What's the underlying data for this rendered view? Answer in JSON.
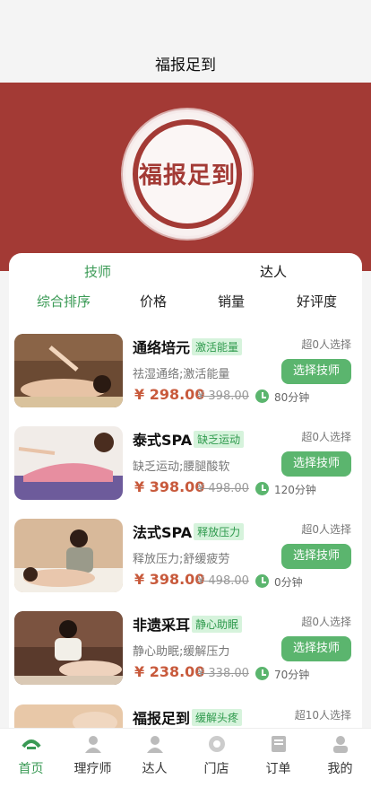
{
  "header": {
    "title": "福报足到"
  },
  "banner": {
    "logo_text": "福报足到"
  },
  "tabs": [
    {
      "label": "技师"
    },
    {
      "label": "达人"
    }
  ],
  "sorts": [
    {
      "label": "综合排序"
    },
    {
      "label": "价格"
    },
    {
      "label": "销量"
    },
    {
      "label": "好评度"
    }
  ],
  "services": [
    {
      "name": "通络培元",
      "tag": "激活能量",
      "count": "超0人选择",
      "desc": "祛湿通络;激活能量",
      "button": "选择技师",
      "price": "¥ 298.00",
      "orig_price": "¥ 398.00",
      "duration": "80分钟"
    },
    {
      "name": "泰式SPA",
      "tag": "缺乏运动",
      "count": "超0人选择",
      "desc": "缺乏运动;腰腿酸软",
      "button": "选择技师",
      "price": "¥ 398.00",
      "orig_price": "¥ 498.00",
      "duration": "120分钟"
    },
    {
      "name": "法式SPA",
      "tag": "释放压力",
      "count": "超0人选择",
      "desc": "释放压力;舒缓疲劳",
      "button": "选择技师",
      "price": "¥ 398.00",
      "orig_price": "¥ 498.00",
      "duration": "0分钟"
    },
    {
      "name": "非遗采耳",
      "tag": "静心助眠",
      "count": "超0人选择",
      "desc": "静心助眠;缓解压力",
      "button": "选择技师",
      "price": "¥ 238.00",
      "orig_price": "¥ 338.00",
      "duration": "70分钟"
    },
    {
      "name": "福报足到",
      "tag": "缓解头疼",
      "count": "超10人选择"
    }
  ],
  "nav": [
    {
      "label": "首页"
    },
    {
      "label": "理疗师"
    },
    {
      "label": "达人"
    },
    {
      "label": "门店"
    },
    {
      "label": "订单"
    },
    {
      "label": "我的"
    }
  ],
  "colors": {
    "brand_red": "#a33a35",
    "accent_green": "#5bb56e",
    "price_red": "#c85a3c"
  }
}
